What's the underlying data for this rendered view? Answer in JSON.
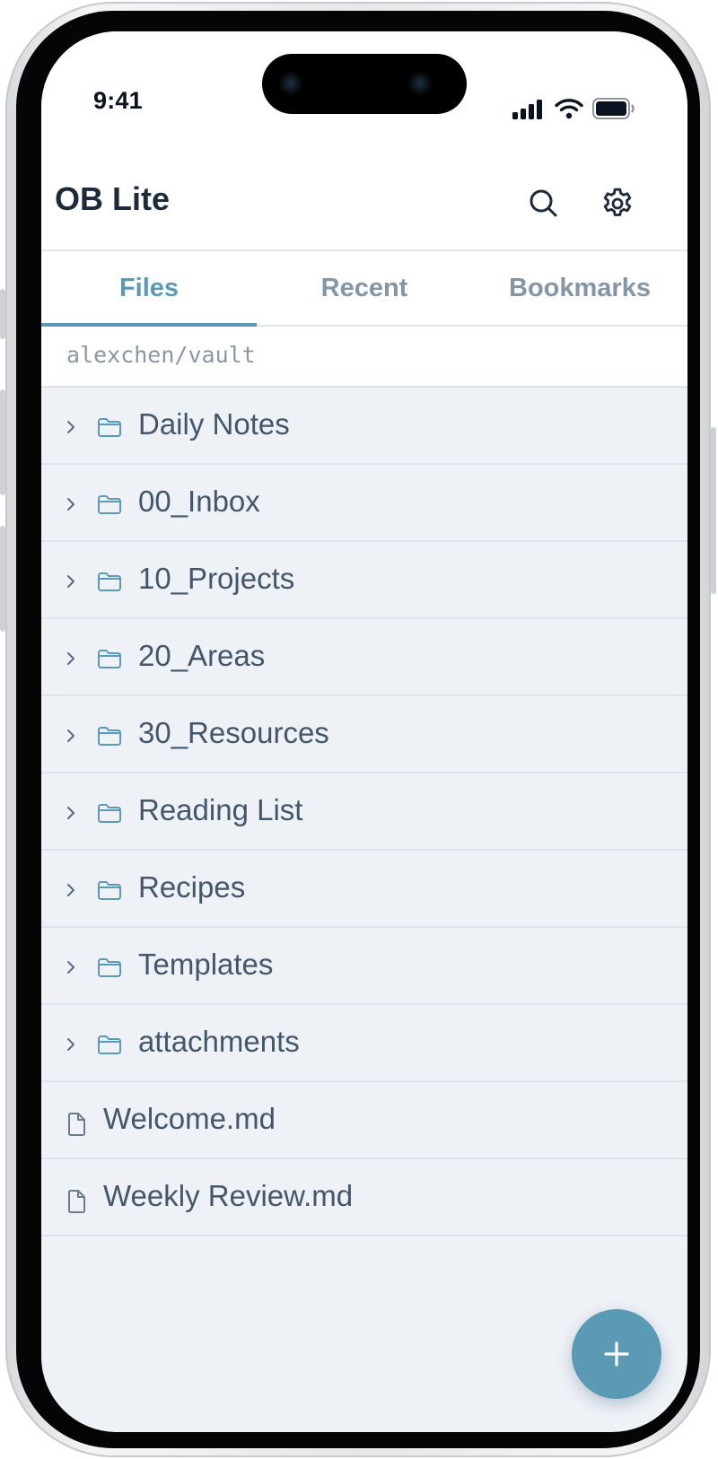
{
  "status_bar": {
    "time": "9:41"
  },
  "header": {
    "title": "OB Lite",
    "search_icon": "search-icon",
    "settings_icon": "gear-icon"
  },
  "tabs": [
    {
      "label": "Files",
      "active": true
    },
    {
      "label": "Recent",
      "active": false
    },
    {
      "label": "Bookmarks",
      "active": false
    }
  ],
  "vault_path": "alexchen/vault",
  "folders": [
    {
      "name": "Daily Notes"
    },
    {
      "name": "00_Inbox"
    },
    {
      "name": "10_Projects"
    },
    {
      "name": "20_Areas"
    },
    {
      "name": "30_Resources"
    },
    {
      "name": "Reading List"
    },
    {
      "name": "Recipes"
    },
    {
      "name": "Templates"
    },
    {
      "name": "attachments"
    }
  ],
  "files": [
    {
      "name": "Welcome.md"
    },
    {
      "name": "Weekly Review.md"
    }
  ],
  "fab": {
    "icon": "plus-icon"
  },
  "colors": {
    "accent": "#5b9ab5",
    "background": "#eef1f6",
    "text": "#44566a",
    "title": "#1d2b3a"
  }
}
